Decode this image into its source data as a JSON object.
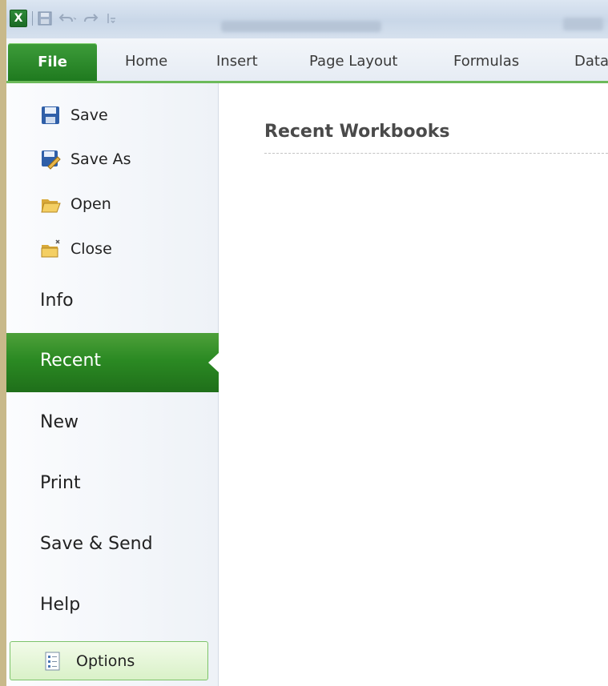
{
  "quick_access": {
    "app_icon_glyph": "X",
    "icons": [
      "excel-icon",
      "save-icon",
      "undo-icon",
      "redo-icon",
      "customize-icon"
    ]
  },
  "ribbon": {
    "tabs": [
      {
        "label": "File"
      },
      {
        "label": "Home"
      },
      {
        "label": "Insert"
      },
      {
        "label": "Page Layout"
      },
      {
        "label": "Formulas"
      },
      {
        "label": "Data"
      }
    ]
  },
  "backstage": {
    "commands": [
      {
        "label": "Save",
        "icon": "save-icon"
      },
      {
        "label": "Save As",
        "icon": "save-as-icon"
      },
      {
        "label": "Open",
        "icon": "open-folder-icon"
      },
      {
        "label": "Close",
        "icon": "close-folder-icon"
      }
    ],
    "nav": [
      {
        "label": "Info"
      },
      {
        "label": "Recent"
      },
      {
        "label": "New"
      },
      {
        "label": "Print"
      },
      {
        "label": "Save & Send"
      },
      {
        "label": "Help"
      }
    ],
    "options": {
      "label": "Options",
      "icon": "options-icon"
    },
    "selected": "Recent"
  },
  "content": {
    "title": "Recent Workbooks"
  },
  "colors": {
    "accent_green": "#2b8a23",
    "file_tab": "#1f7a1f",
    "ribbon_line": "#6cba5a"
  }
}
